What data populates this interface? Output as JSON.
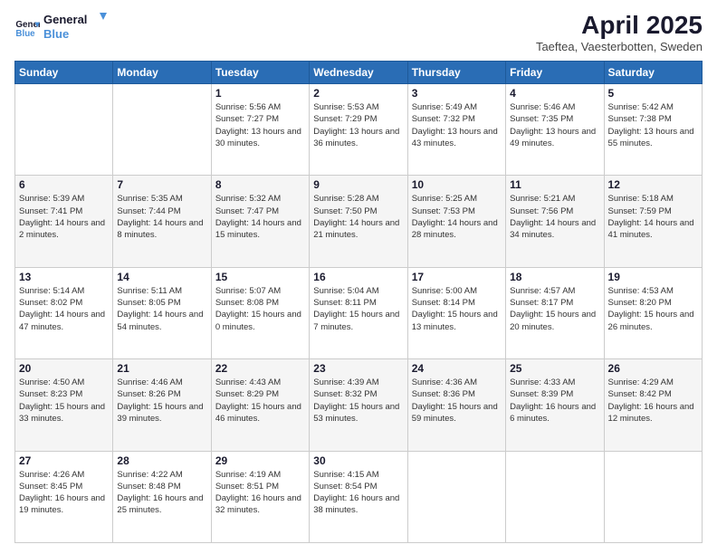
{
  "header": {
    "logo_line1": "General",
    "logo_line2": "Blue",
    "title": "April 2025",
    "subtitle": "Taeftea, Vaesterbotten, Sweden"
  },
  "weekdays": [
    "Sunday",
    "Monday",
    "Tuesday",
    "Wednesday",
    "Thursday",
    "Friday",
    "Saturday"
  ],
  "weeks": [
    [
      {
        "day": "",
        "info": ""
      },
      {
        "day": "",
        "info": ""
      },
      {
        "day": "1",
        "info": "Sunrise: 5:56 AM\nSunset: 7:27 PM\nDaylight: 13 hours and 30 minutes."
      },
      {
        "day": "2",
        "info": "Sunrise: 5:53 AM\nSunset: 7:29 PM\nDaylight: 13 hours and 36 minutes."
      },
      {
        "day": "3",
        "info": "Sunrise: 5:49 AM\nSunset: 7:32 PM\nDaylight: 13 hours and 43 minutes."
      },
      {
        "day": "4",
        "info": "Sunrise: 5:46 AM\nSunset: 7:35 PM\nDaylight: 13 hours and 49 minutes."
      },
      {
        "day": "5",
        "info": "Sunrise: 5:42 AM\nSunset: 7:38 PM\nDaylight: 13 hours and 55 minutes."
      }
    ],
    [
      {
        "day": "6",
        "info": "Sunrise: 5:39 AM\nSunset: 7:41 PM\nDaylight: 14 hours and 2 minutes."
      },
      {
        "day": "7",
        "info": "Sunrise: 5:35 AM\nSunset: 7:44 PM\nDaylight: 14 hours and 8 minutes."
      },
      {
        "day": "8",
        "info": "Sunrise: 5:32 AM\nSunset: 7:47 PM\nDaylight: 14 hours and 15 minutes."
      },
      {
        "day": "9",
        "info": "Sunrise: 5:28 AM\nSunset: 7:50 PM\nDaylight: 14 hours and 21 minutes."
      },
      {
        "day": "10",
        "info": "Sunrise: 5:25 AM\nSunset: 7:53 PM\nDaylight: 14 hours and 28 minutes."
      },
      {
        "day": "11",
        "info": "Sunrise: 5:21 AM\nSunset: 7:56 PM\nDaylight: 14 hours and 34 minutes."
      },
      {
        "day": "12",
        "info": "Sunrise: 5:18 AM\nSunset: 7:59 PM\nDaylight: 14 hours and 41 minutes."
      }
    ],
    [
      {
        "day": "13",
        "info": "Sunrise: 5:14 AM\nSunset: 8:02 PM\nDaylight: 14 hours and 47 minutes."
      },
      {
        "day": "14",
        "info": "Sunrise: 5:11 AM\nSunset: 8:05 PM\nDaylight: 14 hours and 54 minutes."
      },
      {
        "day": "15",
        "info": "Sunrise: 5:07 AM\nSunset: 8:08 PM\nDaylight: 15 hours and 0 minutes."
      },
      {
        "day": "16",
        "info": "Sunrise: 5:04 AM\nSunset: 8:11 PM\nDaylight: 15 hours and 7 minutes."
      },
      {
        "day": "17",
        "info": "Sunrise: 5:00 AM\nSunset: 8:14 PM\nDaylight: 15 hours and 13 minutes."
      },
      {
        "day": "18",
        "info": "Sunrise: 4:57 AM\nSunset: 8:17 PM\nDaylight: 15 hours and 20 minutes."
      },
      {
        "day": "19",
        "info": "Sunrise: 4:53 AM\nSunset: 8:20 PM\nDaylight: 15 hours and 26 minutes."
      }
    ],
    [
      {
        "day": "20",
        "info": "Sunrise: 4:50 AM\nSunset: 8:23 PM\nDaylight: 15 hours and 33 minutes."
      },
      {
        "day": "21",
        "info": "Sunrise: 4:46 AM\nSunset: 8:26 PM\nDaylight: 15 hours and 39 minutes."
      },
      {
        "day": "22",
        "info": "Sunrise: 4:43 AM\nSunset: 8:29 PM\nDaylight: 15 hours and 46 minutes."
      },
      {
        "day": "23",
        "info": "Sunrise: 4:39 AM\nSunset: 8:32 PM\nDaylight: 15 hours and 53 minutes."
      },
      {
        "day": "24",
        "info": "Sunrise: 4:36 AM\nSunset: 8:36 PM\nDaylight: 15 hours and 59 minutes."
      },
      {
        "day": "25",
        "info": "Sunrise: 4:33 AM\nSunset: 8:39 PM\nDaylight: 16 hours and 6 minutes."
      },
      {
        "day": "26",
        "info": "Sunrise: 4:29 AM\nSunset: 8:42 PM\nDaylight: 16 hours and 12 minutes."
      }
    ],
    [
      {
        "day": "27",
        "info": "Sunrise: 4:26 AM\nSunset: 8:45 PM\nDaylight: 16 hours and 19 minutes."
      },
      {
        "day": "28",
        "info": "Sunrise: 4:22 AM\nSunset: 8:48 PM\nDaylight: 16 hours and 25 minutes."
      },
      {
        "day": "29",
        "info": "Sunrise: 4:19 AM\nSunset: 8:51 PM\nDaylight: 16 hours and 32 minutes."
      },
      {
        "day": "30",
        "info": "Sunrise: 4:15 AM\nSunset: 8:54 PM\nDaylight: 16 hours and 38 minutes."
      },
      {
        "day": "",
        "info": ""
      },
      {
        "day": "",
        "info": ""
      },
      {
        "day": "",
        "info": ""
      }
    ]
  ]
}
